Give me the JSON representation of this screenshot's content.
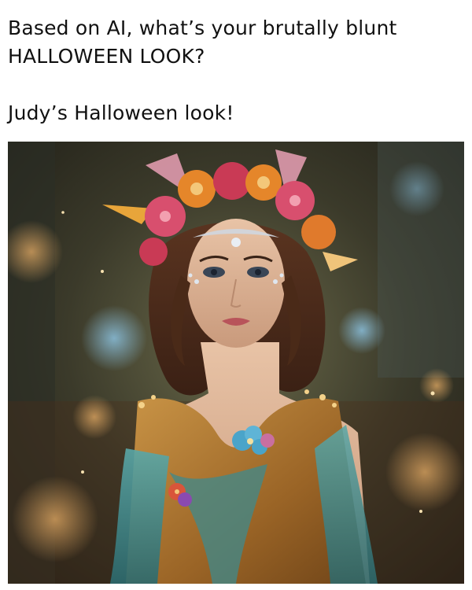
{
  "post": {
    "title_line1": "Based on AI, what’s your brutally blunt",
    "title_line2": "HALLOWEEN LOOK?",
    "subtitle": "Judy’s Halloween look!"
  },
  "photo": {
    "subject": "woman in fairy costume with flower crown"
  },
  "colors": {
    "background": "#ffffff",
    "text": "#111111",
    "dress_gold": "#b8823a",
    "dress_teal": "#3f8a8c",
    "flower_crown_orange": "#e5862a",
    "flower_crown_pink": "#d9456b"
  }
}
